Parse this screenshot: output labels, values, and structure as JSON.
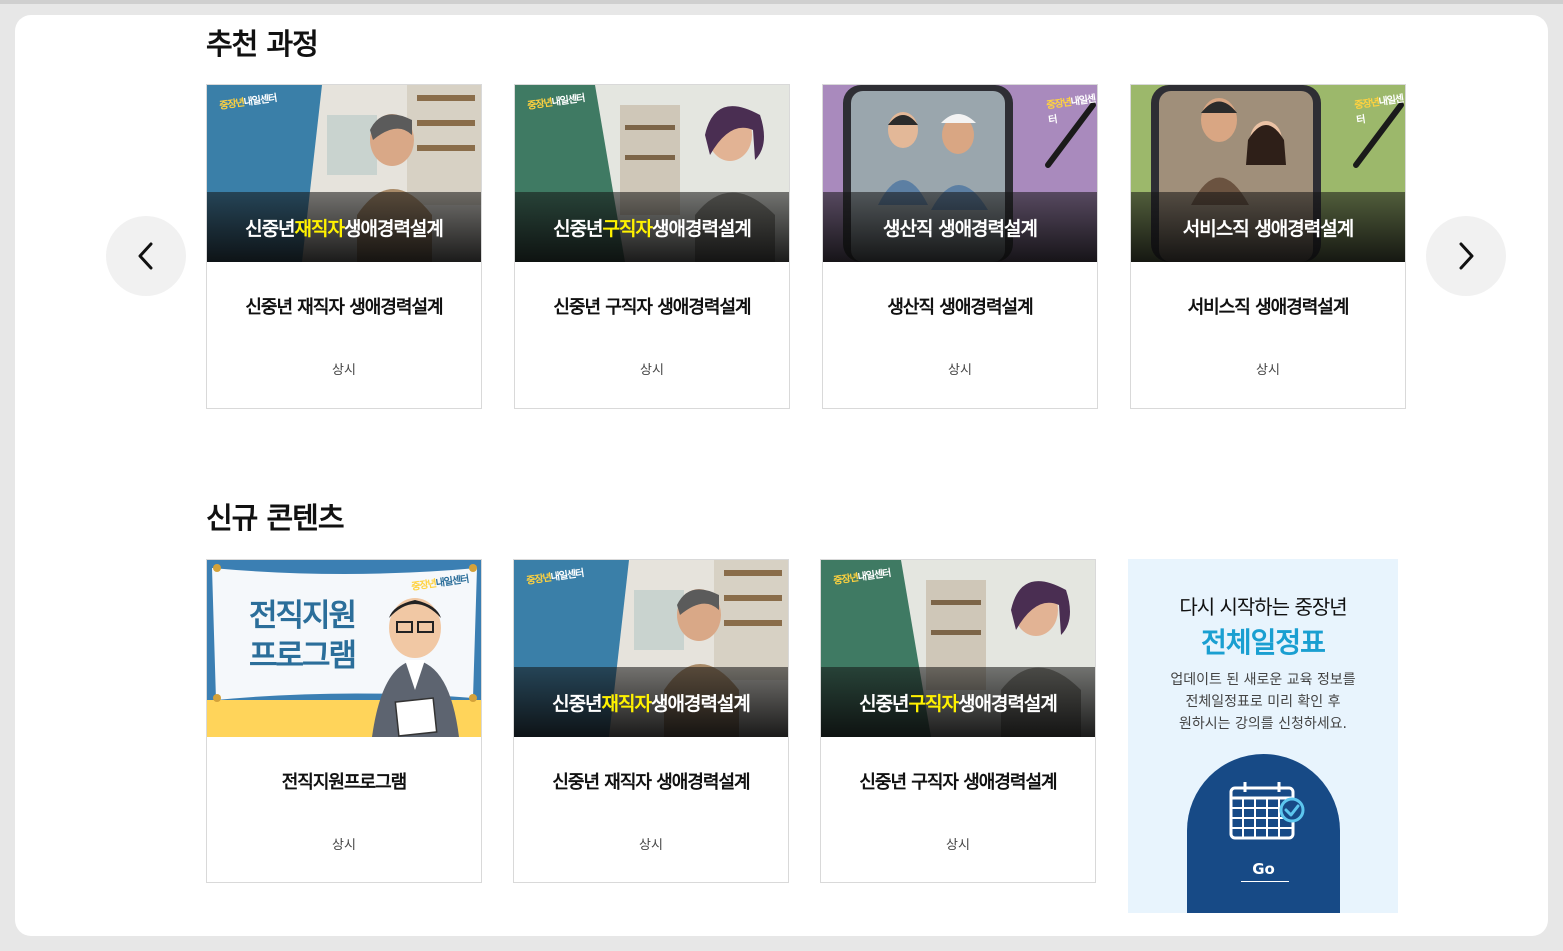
{
  "sections": {
    "recommended": {
      "title": "추천 과정",
      "cards": [
        {
          "banner_pre": "신중년 ",
          "banner_hl": "재직자",
          "banner_post": " 생애경력설계",
          "title": "신중년 재직자 생애경력설계",
          "period": "상시",
          "theme": "blue"
        },
        {
          "banner_pre": "신중년 ",
          "banner_hl": "구직자",
          "banner_post": " 생애경력설계",
          "title": "신중년 구직자 생애경력설계",
          "period": "상시",
          "theme": "green"
        },
        {
          "banner_pre": "",
          "banner_hl": "",
          "banner_post": "생산직 생애경력설계",
          "title": "생산직 생애경력설계",
          "period": "상시",
          "theme": "purple"
        },
        {
          "banner_pre": "",
          "banner_hl": "",
          "banner_post": "서비스직 생애경력설계",
          "title": "서비스직 생애경력설계",
          "period": "상시",
          "theme": "olive"
        }
      ]
    },
    "new_contents": {
      "title": "신규 콘텐츠",
      "cards": [
        {
          "poster_text": [
            "전직지원",
            "프로그램"
          ],
          "title": "전직지원프로그램",
          "period": "상시",
          "theme": "poster"
        },
        {
          "banner_pre": "신중년 ",
          "banner_hl": "재직자",
          "banner_post": " 생애경력설계",
          "title": "신중년 재직자 생애경력설계",
          "period": "상시",
          "theme": "blue"
        },
        {
          "banner_pre": "신중년 ",
          "banner_hl": "구직자",
          "banner_post": " 생애경력설계",
          "title": "신중년 구직자 생애경력설계",
          "period": "상시",
          "theme": "green"
        }
      ]
    }
  },
  "schedule_promo": {
    "line1": "다시 시작하는 중장년",
    "line2": "전체일정표",
    "desc": [
      "업데이트 된 새로운 교육 정보를",
      "전체일정표로 미리 확인 후",
      "원하시는 강의를 신청하세요."
    ],
    "go_label": "Go"
  },
  "logo_text": {
    "a": "중장년",
    "b": "내일센터"
  },
  "icons": {
    "prev": "chevron-left-icon",
    "next": "chevron-right-icon",
    "calendar": "calendar-check-icon"
  },
  "colors": {
    "highlight": "#fff200",
    "accent_blue": "#1a9fd1",
    "navy": "#174a86",
    "promo_bg": "#e8f4fd"
  }
}
